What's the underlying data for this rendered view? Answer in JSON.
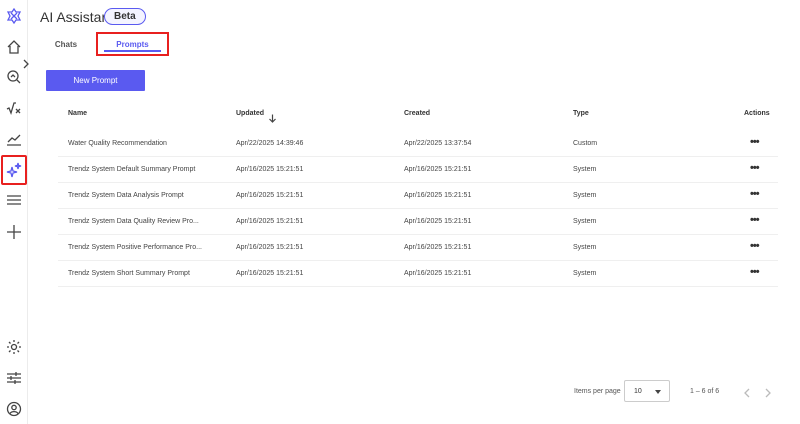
{
  "header": {
    "title": "AI Assistant",
    "badge": "Beta"
  },
  "tabs": [
    {
      "label": "Chats",
      "active": false
    },
    {
      "label": "Prompts",
      "active": true
    }
  ],
  "actions": {
    "new_prompt": "New Prompt"
  },
  "table": {
    "columns": {
      "name": "Name",
      "updated": "Updated",
      "created": "Created",
      "type": "Type",
      "actions": "Actions"
    },
    "sort": {
      "column": "updated",
      "direction": "descending"
    },
    "rows": [
      {
        "name": "Water Quality Recommendation",
        "updated": "Apr/22/2025 14:39:46",
        "created": "Apr/22/2025 13:37:54",
        "type": "Custom",
        "menu": "•••"
      },
      {
        "name": "Trendz System Default Summary Prompt",
        "updated": "Apr/16/2025 15:21:51",
        "created": "Apr/16/2025 15:21:51",
        "type": "System",
        "menu": "•••"
      },
      {
        "name": "Trendz System Data Analysis Prompt",
        "updated": "Apr/16/2025 15:21:51",
        "created": "Apr/16/2025 15:21:51",
        "type": "System",
        "menu": "•••"
      },
      {
        "name": "Trendz System Data Quality Review Pro...",
        "updated": "Apr/16/2025 15:21:51",
        "created": "Apr/16/2025 15:21:51",
        "type": "System",
        "menu": "•••"
      },
      {
        "name": "Trendz System Positive Performance Pro...",
        "updated": "Apr/16/2025 15:21:51",
        "created": "Apr/16/2025 15:21:51",
        "type": "System",
        "menu": "•••"
      },
      {
        "name": "Trendz System Short Summary Prompt",
        "updated": "Apr/16/2025 15:21:51",
        "created": "Apr/16/2025 15:21:51",
        "type": "System",
        "menu": "•••"
      }
    ]
  },
  "paginator": {
    "items_per_page_label": "Items per page",
    "page_size": "10",
    "range": "1 – 6 of 6"
  },
  "sidebar": {
    "items": [
      {
        "icon": "logo-icon"
      },
      {
        "icon": "home-icon"
      },
      {
        "icon": "search-analytics-icon"
      },
      {
        "icon": "formula-icon"
      },
      {
        "icon": "trend-chart-icon"
      },
      {
        "icon": "ai-sparkle-icon",
        "active": true
      },
      {
        "icon": "list-icon"
      },
      {
        "icon": "add-icon"
      },
      {
        "icon": "settings-gear-icon"
      },
      {
        "icon": "sliders-icon"
      },
      {
        "icon": "account-icon"
      }
    ]
  },
  "colors": {
    "accent": "#5a5af0",
    "highlight_border": "#e8201f"
  }
}
